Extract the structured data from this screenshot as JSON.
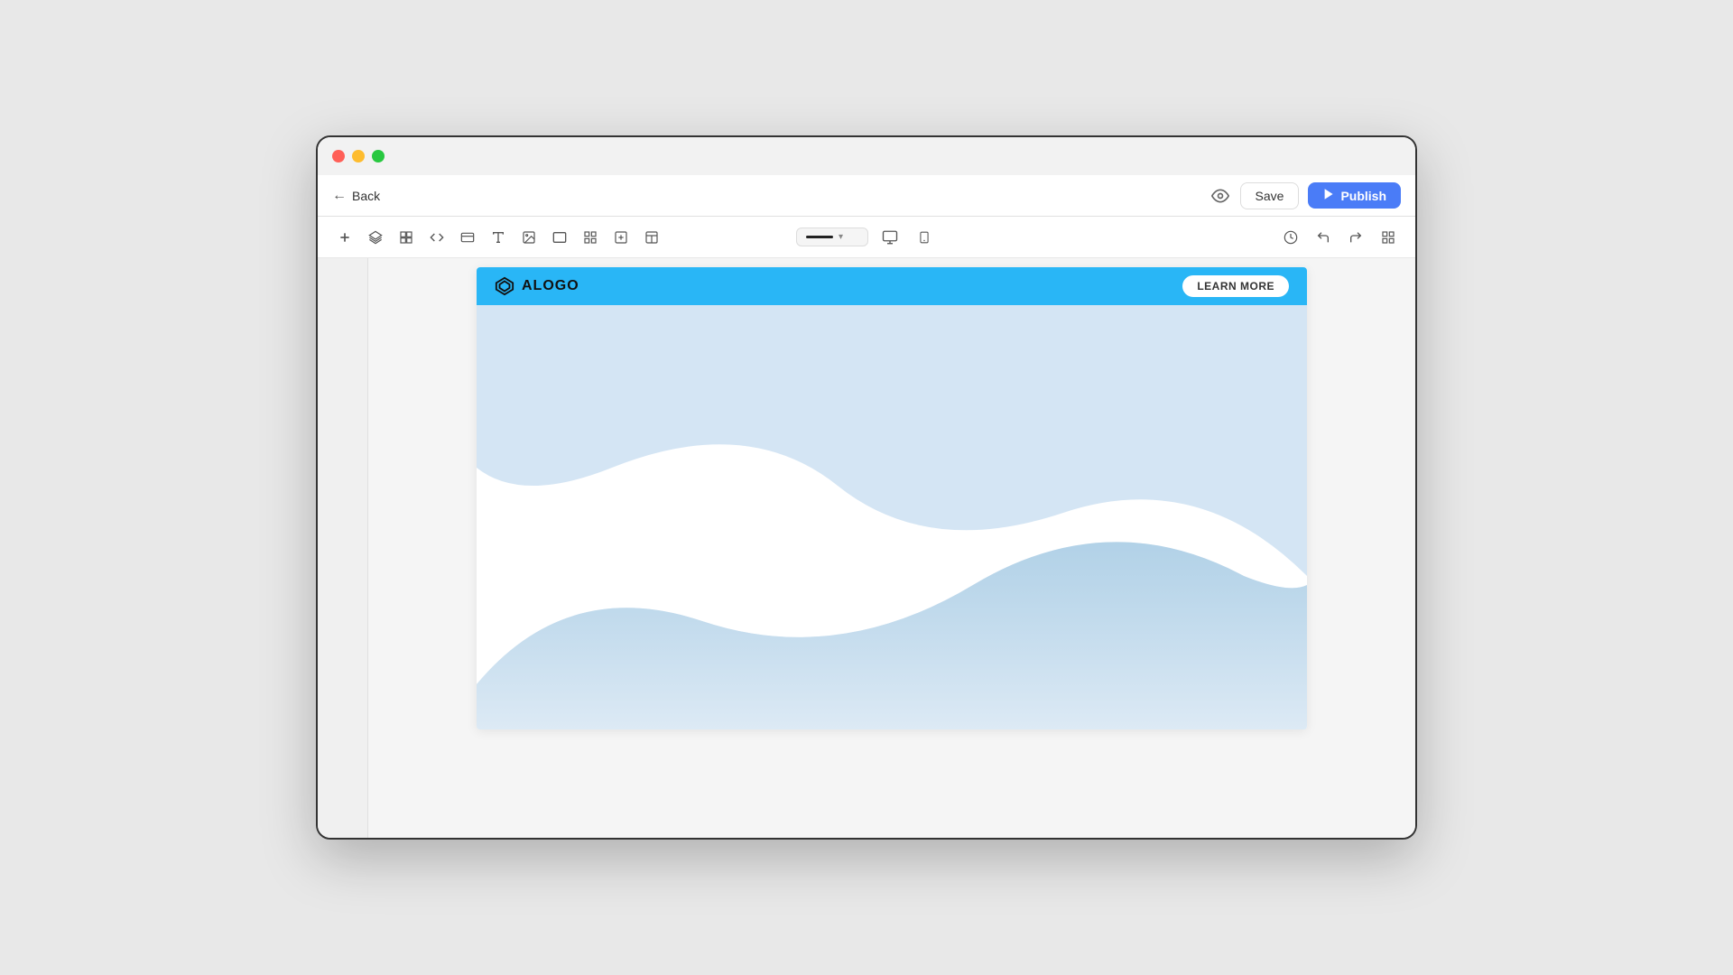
{
  "window": {
    "traffic": {
      "close": "close",
      "minimize": "minimize",
      "maximize": "maximize"
    }
  },
  "nav": {
    "back_label": "Back",
    "eye_icon": "eye",
    "save_label": "Save",
    "publish_label": "Publish",
    "publish_icon": "▶"
  },
  "toolbar": {
    "add_icon": "+",
    "layers_icon": "⊕",
    "components_icon": "⬡",
    "code_icon": "</>",
    "forms_icon": "⊟",
    "text_icon": "T",
    "media_icon": "⊚",
    "container_icon": "▭",
    "gallery_icon": "⊞",
    "embed_icon": "⊡",
    "layout_icon": "⊟",
    "divider_preview": "——",
    "divider_dropdown_icon": "▾",
    "desktop_icon": "🖥",
    "mobile_icon": "📱",
    "history_icon": "⏱",
    "undo_icon": "↩",
    "redo_icon": "↪",
    "grid_icon": "⊞"
  },
  "site": {
    "logo_text": "ALOGO",
    "learn_more_label": "LEARN MORE",
    "header_bg": "#29b6f6",
    "wave_color_top": "#b3d4f0",
    "wave_color_bottom": "#dce9f7"
  }
}
